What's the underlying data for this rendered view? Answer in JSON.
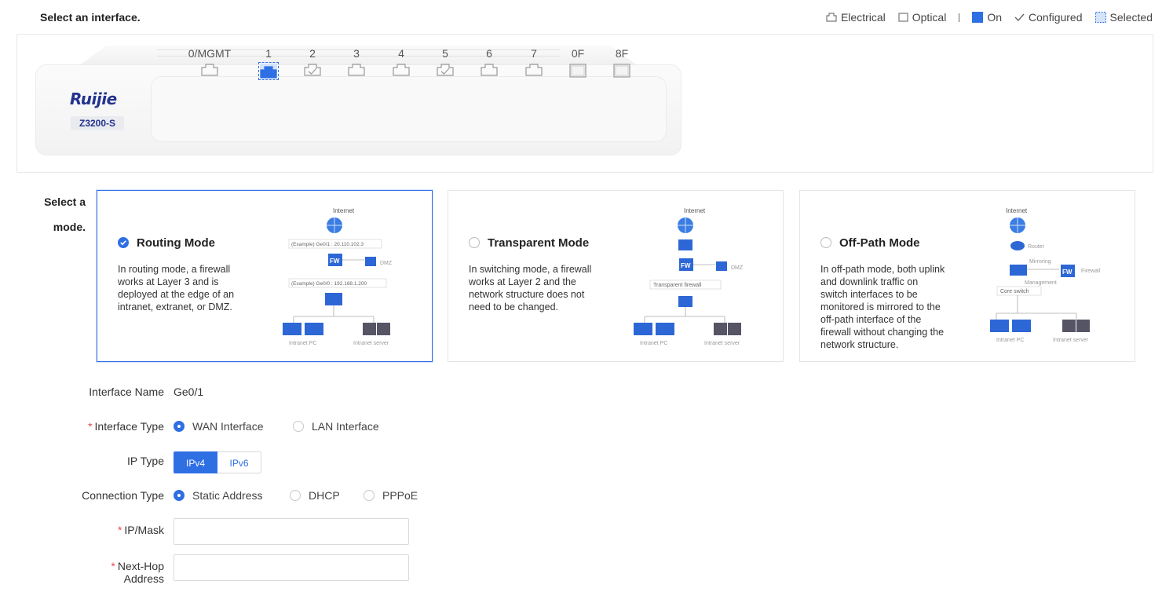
{
  "header": {
    "title": "Select an interface.",
    "legend": {
      "electrical": "Electrical",
      "optical": "Optical",
      "on": "On",
      "configured": "Configured",
      "selected": "Selected"
    }
  },
  "device": {
    "brand": "Ruijie",
    "model": "Z3200-S",
    "ports": [
      {
        "label": "0/MGMT",
        "kind": "electrical",
        "state": "normal"
      },
      {
        "label": "1",
        "kind": "electrical",
        "state": "selected"
      },
      {
        "label": "2",
        "kind": "electrical",
        "state": "configured"
      },
      {
        "label": "3",
        "kind": "electrical",
        "state": "normal"
      },
      {
        "label": "4",
        "kind": "electrical",
        "state": "normal"
      },
      {
        "label": "5",
        "kind": "electrical",
        "state": "configured"
      },
      {
        "label": "6",
        "kind": "electrical",
        "state": "normal"
      },
      {
        "label": "7",
        "kind": "electrical",
        "state": "normal"
      },
      {
        "label": "0F",
        "kind": "optical",
        "state": "normal"
      },
      {
        "label": "8F",
        "kind": "optical",
        "state": "normal"
      }
    ]
  },
  "mode": {
    "label_line1": "Select a",
    "label_line2": "mode.",
    "cards": [
      {
        "title": "Routing Mode",
        "selected": true,
        "desc": "In routing mode, a firewall works at Layer 3 and is deployed at the edge of an intranet, extranet, or DMZ.",
        "diagram": {
          "internet": "Internet",
          "uplink": "(Example) Ge0/1 : 20.110.102.3",
          "dmz": "DMZ",
          "downlink": "(Example)  Ge0/0 : 192.168.1.200",
          "pc": "Intranet PC",
          "server": "Intranet server"
        }
      },
      {
        "title": "Transparent Mode",
        "selected": false,
        "desc": "In switching mode, a firewall works at Layer 2 and the network structure does not need to be changed.",
        "diagram": {
          "internet": "Internet",
          "dmz": "DMZ",
          "fw": "Transparent firewall",
          "pc": "Intranet PC",
          "server": "Intranet server"
        }
      },
      {
        "title": "Off-Path Mode",
        "selected": false,
        "desc": "In off-path mode, both uplink and downlink traffic on switch interfaces to be monitored is mirrored to the off-path interface of the firewall without changing the network structure.",
        "diagram": {
          "internet": "Internet",
          "router": "Router",
          "mirroring": "Mirroring",
          "firewall": "Firewall",
          "management": "Management",
          "core": "Core switch",
          "pc": "Intranet PC",
          "server": "Intranet server"
        }
      }
    ]
  },
  "form": {
    "interface_name": {
      "label": "Interface Name",
      "value": "Ge0/1"
    },
    "interface_type": {
      "label": "Interface Type",
      "options": [
        "WAN Interface",
        "LAN Interface"
      ],
      "selected": "WAN Interface"
    },
    "ip_type": {
      "label": "IP Type",
      "options": [
        "IPv4",
        "IPv6"
      ],
      "selected": "IPv4"
    },
    "connection_type": {
      "label": "Connection Type",
      "options": [
        "Static Address",
        "DHCP",
        "PPPoE"
      ],
      "selected": "Static Address"
    },
    "ip_mask": {
      "label": "IP/Mask",
      "value": ""
    },
    "next_hop": {
      "label": "Next-Hop Address",
      "value": ""
    }
  },
  "colors": {
    "accent": "#2f6fe4",
    "required": "#e84a4a",
    "brand": "#23338f"
  }
}
